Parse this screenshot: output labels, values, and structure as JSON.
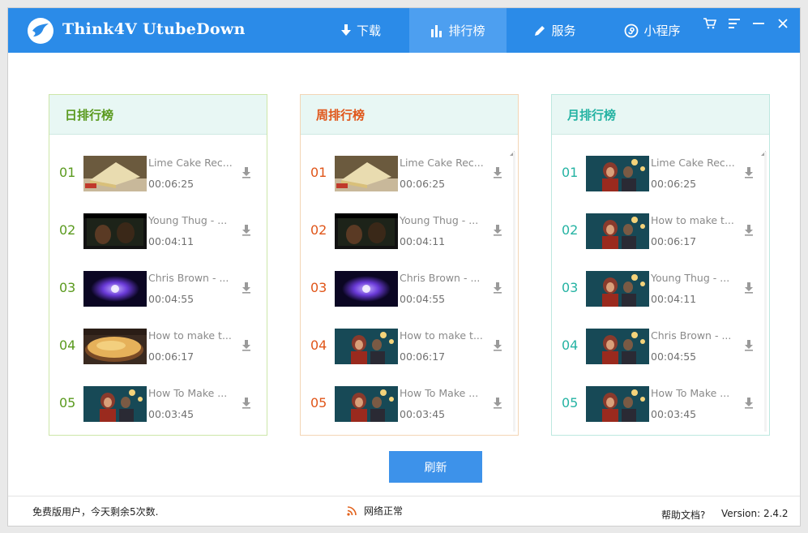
{
  "app": {
    "title": "Think4V  UtubeDown",
    "brand_color": "#2b8be8"
  },
  "nav": [
    {
      "id": "download",
      "label": "下载",
      "icon": "download-icon"
    },
    {
      "id": "ranking",
      "label": "排行榜",
      "icon": "bar-chart-icon",
      "active": true
    },
    {
      "id": "service",
      "label": "服务",
      "icon": "pencil-icon"
    },
    {
      "id": "miniapp",
      "label": "小程序",
      "icon": "mini-program-icon"
    }
  ],
  "window_controls": [
    "cart-icon",
    "menu-icon",
    "minimize-icon",
    "close-icon"
  ],
  "panels": [
    {
      "title": "日排行榜",
      "color": "#5a9a1e",
      "items": [
        {
          "rank": "01",
          "title": "Lime Cake Rec...",
          "duration": "00:06:25",
          "thumb": "cake"
        },
        {
          "rank": "02",
          "title": "Young Thug - ...",
          "duration": "00:04:11",
          "thumb": "dark"
        },
        {
          "rank": "03",
          "title": "Chris Brown - ...",
          "duration": "00:04:55",
          "thumb": "purple"
        },
        {
          "rank": "04",
          "title": "How to make t...",
          "duration": "00:06:17",
          "thumb": "pie"
        },
        {
          "rank": "05",
          "title": "How To Make ...",
          "duration": "00:03:45",
          "thumb": "couple"
        }
      ]
    },
    {
      "title": "周排行榜",
      "color": "#e0561a",
      "items": [
        {
          "rank": "01",
          "title": "Lime Cake Rec...",
          "duration": "00:06:25",
          "thumb": "cake"
        },
        {
          "rank": "02",
          "title": "Young Thug - ...",
          "duration": "00:04:11",
          "thumb": "dark"
        },
        {
          "rank": "03",
          "title": "Chris Brown - ...",
          "duration": "00:04:55",
          "thumb": "purple"
        },
        {
          "rank": "04",
          "title": "How to make t...",
          "duration": "00:06:17",
          "thumb": "couple"
        },
        {
          "rank": "05",
          "title": "How To Make ...",
          "duration": "00:03:45",
          "thumb": "couple"
        }
      ]
    },
    {
      "title": "月排行榜",
      "color": "#25b3a3",
      "items": [
        {
          "rank": "01",
          "title": "Lime Cake Rec...",
          "duration": "00:06:25",
          "thumb": "couple"
        },
        {
          "rank": "02",
          "title": "How to make t...",
          "duration": "00:06:17",
          "thumb": "couple"
        },
        {
          "rank": "03",
          "title": "Young Thug - ...",
          "duration": "00:04:11",
          "thumb": "couple"
        },
        {
          "rank": "04",
          "title": "Chris Brown - ...",
          "duration": "00:04:55",
          "thumb": "couple"
        },
        {
          "rank": "05",
          "title": "How To Make ...",
          "duration": "00:03:45",
          "thumb": "couple"
        }
      ]
    }
  ],
  "refresh_label": "刷新",
  "status": {
    "user_info": "免费版用户，今天剩余5次数.",
    "network": "网络正常",
    "help": "帮助文档?",
    "version": "Version: 2.4.2"
  }
}
